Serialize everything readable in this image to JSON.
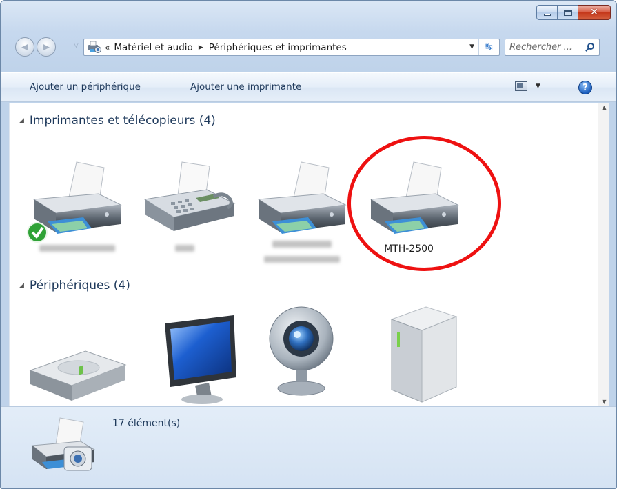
{
  "window": {
    "caption_buttons": {
      "close_glyph": "✕"
    }
  },
  "navigation": {
    "back_arrow": "◀",
    "forward_arrow": "▶",
    "history_arrow": "▽",
    "address": {
      "overflow": "«",
      "crumbs": [
        "Matériel et audio",
        "Périphériques et imprimantes"
      ],
      "separator": "▶",
      "dropdown_arrow": "▼",
      "refresh_glyph": "↹"
    },
    "search": {
      "placeholder": "Rechercher ..."
    }
  },
  "command_bar": {
    "add_device": "Ajouter un périphérique",
    "add_printer": "Ajouter une imprimante",
    "view_dropdown_arrow": "▼",
    "help_glyph": "?"
  },
  "groups": {
    "collapse_arrow": "◢",
    "printers": {
      "title": "Imprimantes et télécopieurs (4)"
    },
    "devices": {
      "title": "Périphériques (4)"
    }
  },
  "printers": {
    "visible_label": "MTH-2500"
  },
  "scrollbar": {
    "up": "▲",
    "down": "▼"
  },
  "details": {
    "count": "17 élément(s)"
  },
  "colors": {
    "highlight": "#ee1111",
    "link_text": "#1e395b",
    "window_frame": "#c6d8ee"
  }
}
